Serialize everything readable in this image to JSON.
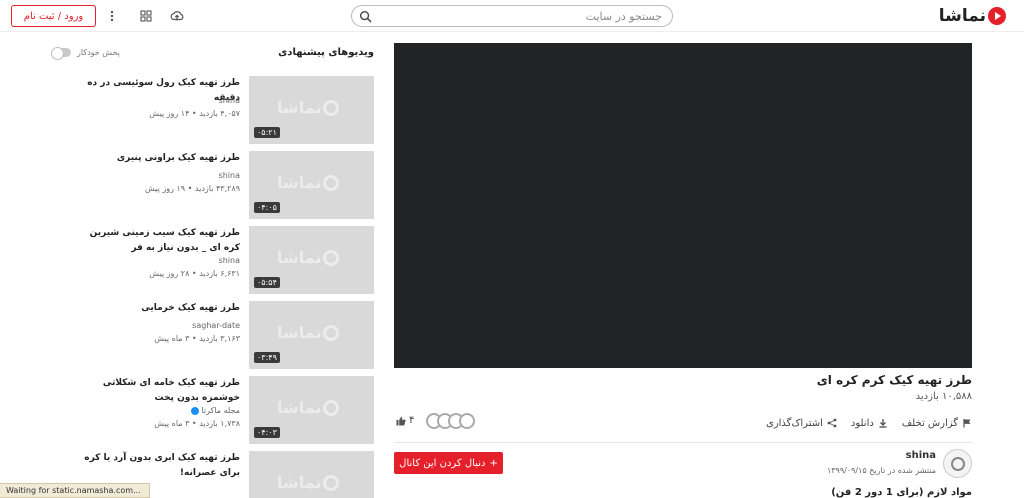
{
  "header": {
    "logo_text": "نماشا",
    "search_placeholder": "جستجو در سایت",
    "login_label": "ورود / ثبت نام"
  },
  "video": {
    "title": "طرز تهیه کیک کرم کره ای",
    "views": "۱۰,۵۸۸ بازدید",
    "likes": "۴",
    "actions": {
      "share": "اشتراک‌گذاری",
      "download": "دانلود",
      "report": "گزارش تخلف"
    },
    "follow_label": "دنبال کردن این کانال",
    "channel_name": "shina",
    "published": "منتشر شده در تاریخ ۱۳۹۹/۰۹/۱۵",
    "ingredients": "مواد لازم (برای 1 دور 2 فن)"
  },
  "sidebar": {
    "title": "ویدیوهای پیشنهادی",
    "autoplay_label": "پخش خودکار",
    "items": [
      {
        "title": "طرز تهیه کیک رول سوئیسی در ده دقیقه",
        "channel": "shina",
        "views": "۴,۰۵۷ بازدید",
        "age": "۱۴ روز پیش",
        "duration": "۰۵:۲۱"
      },
      {
        "title": "طرز تهیه کیک براونی پنیری",
        "channel": "shina",
        "views": "۴۳,۲۸۹ بازدید",
        "age": "۱۹ روز پیش",
        "duration": "۰۴:۰۵"
      },
      {
        "title": "طرز تهیه کیک سیب زمینی شیرین کره ای _ بدون نیاز به فر",
        "channel": "shina",
        "views": "۶,۶۳۱ بازدید",
        "age": "۲۸ روز پیش",
        "duration": "۰۵:۵۴"
      },
      {
        "title": "طرز تهیه کیک خرمایی",
        "channel": "saghar-date",
        "views": "۳,۱۶۳ بازدید",
        "age": "۳ ماه پیش",
        "duration": "۰۳:۴۹"
      },
      {
        "title": "طرز تهیه کیک خامه ای شکلاتی خوشمزه بدون پخت",
        "channel": "مجله ماکرتا",
        "views": "۱,۷۳۸ بازدید",
        "age": "۳ ماه پیش",
        "duration": "۰۴:۰۳"
      },
      {
        "title": "طرز تهیه کیک ابری بدون آرد یا کره برای عصرانه!",
        "channel": "",
        "views": "",
        "age": "",
        "duration": ""
      }
    ]
  },
  "status_bar": "Waiting for static.namasha.com...",
  "colors": {
    "accent": "#e5202b",
    "player_bg": "#212325"
  }
}
